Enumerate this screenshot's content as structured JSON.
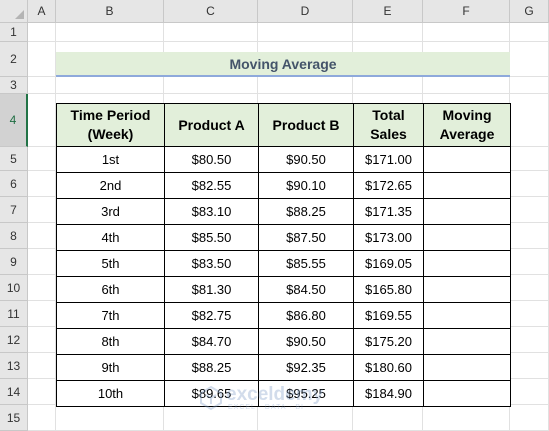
{
  "sheet": {
    "columns": [
      "A",
      "B",
      "C",
      "D",
      "E",
      "F",
      "G"
    ],
    "rows": [
      "1",
      "2",
      "3",
      "4",
      "5",
      "6",
      "7",
      "8",
      "9",
      "10",
      "11",
      "12",
      "13",
      "14",
      "15"
    ],
    "selected_row": "4"
  },
  "title": "Moving Average",
  "table": {
    "headers": [
      "Time Period (Week)",
      "Product A",
      "Product B",
      "Total Sales",
      "Moving Average"
    ],
    "header_lines": [
      [
        "Time Period",
        "(Week)"
      ],
      [
        "Product A"
      ],
      [
        "Product B"
      ],
      [
        "Total",
        "Sales"
      ],
      [
        "Moving",
        "Average"
      ]
    ],
    "rows": [
      [
        "1st",
        "$80.50",
        "$90.50",
        "$171.00",
        ""
      ],
      [
        "2nd",
        "$82.55",
        "$90.10",
        "$172.65",
        ""
      ],
      [
        "3rd",
        "$83.10",
        "$88.25",
        "$171.35",
        ""
      ],
      [
        "4th",
        "$85.50",
        "$87.50",
        "$173.00",
        ""
      ],
      [
        "5th",
        "$83.50",
        "$85.55",
        "$169.05",
        ""
      ],
      [
        "6th",
        "$81.30",
        "$84.50",
        "$165.80",
        ""
      ],
      [
        "7th",
        "$82.75",
        "$86.80",
        "$169.55",
        ""
      ],
      [
        "8th",
        "$84.70",
        "$90.50",
        "$175.20",
        ""
      ],
      [
        "9th",
        "$88.25",
        "$92.35",
        "$180.60",
        ""
      ],
      [
        "10th",
        "$89.65",
        "$95.25",
        "$184.90",
        ""
      ]
    ]
  },
  "watermark": {
    "name": "exceldemy",
    "tagline": "EXCEL · DATA · BI"
  },
  "colors": {
    "header_fill": "#e2efda",
    "title_text": "#44546a",
    "title_underline": "#8ea9db",
    "selection": "#217346"
  }
}
